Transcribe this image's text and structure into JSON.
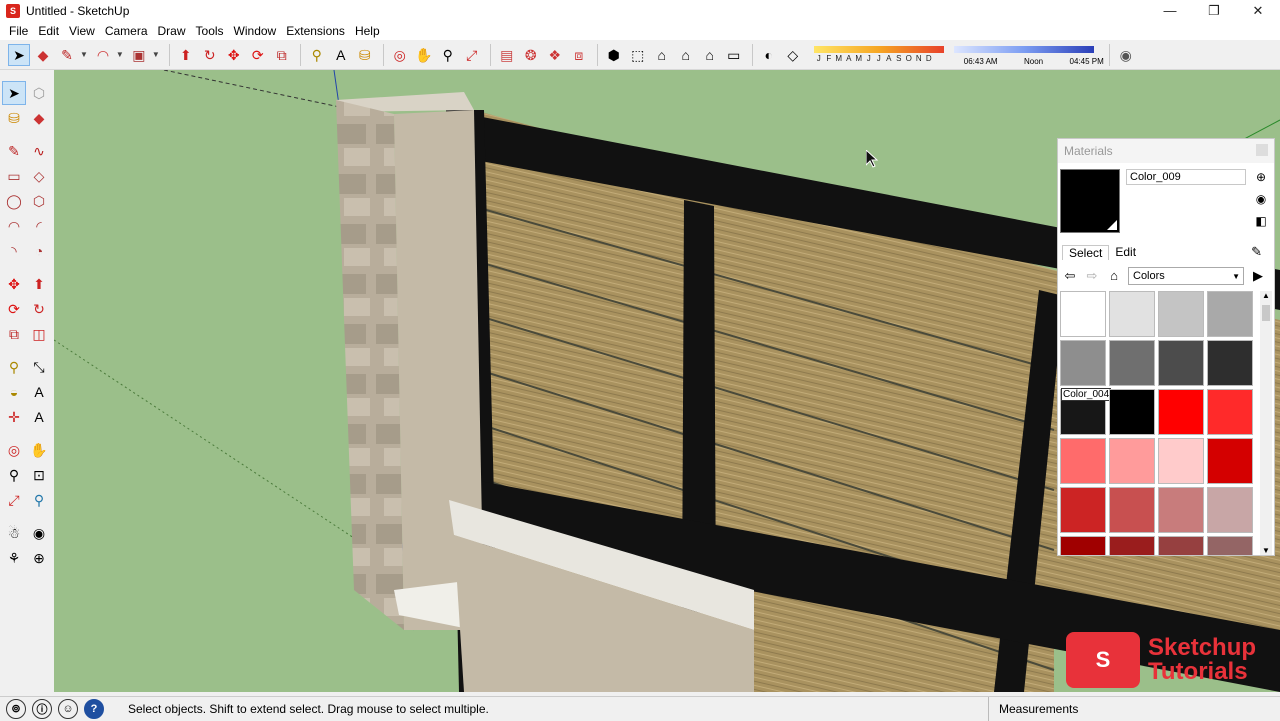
{
  "window": {
    "title": "Untitled - SketchUp",
    "controls": [
      "—",
      "❐",
      "✕"
    ]
  },
  "menu": [
    "File",
    "Edit",
    "View",
    "Camera",
    "Draw",
    "Tools",
    "Window",
    "Extensions",
    "Help"
  ],
  "shadow": {
    "months": [
      "J",
      "F",
      "M",
      "A",
      "M",
      "J",
      "J",
      "A",
      "S",
      "O",
      "N",
      "D"
    ],
    "time_start": "06:43 AM",
    "time_mid": "Noon",
    "time_end": "04:45 PM"
  },
  "materials": {
    "panel_title": "Materials",
    "current_name": "Color_009",
    "current_color": "#000000",
    "tabs": [
      "Select",
      "Edit"
    ],
    "library": "Colors",
    "hover_label": "Color_004",
    "swatches": [
      "#ffffff",
      "#e1e1e1",
      "#c4c4c4",
      "#a9a9a9",
      "#8e8e8e",
      "#6f6f6f",
      "#4c4c4c",
      "#2e2e2e",
      "#171717",
      "#000000",
      "#ff0000",
      "#ff2a2a",
      "#ff6b6b",
      "#ff9b9b",
      "#ffcbcb",
      "#d40000",
      "#cc2424",
      "#c85050",
      "#c87c7c",
      "#c8a6a6",
      "#a00000",
      "#9a1d1d",
      "#964040",
      "#946565"
    ]
  },
  "status": {
    "text": "Select objects. Shift to extend select. Drag mouse to select multiple.",
    "measurements_label": "Measurements"
  },
  "brand": {
    "line1": "Sketchup",
    "line2": "Tutorials"
  }
}
